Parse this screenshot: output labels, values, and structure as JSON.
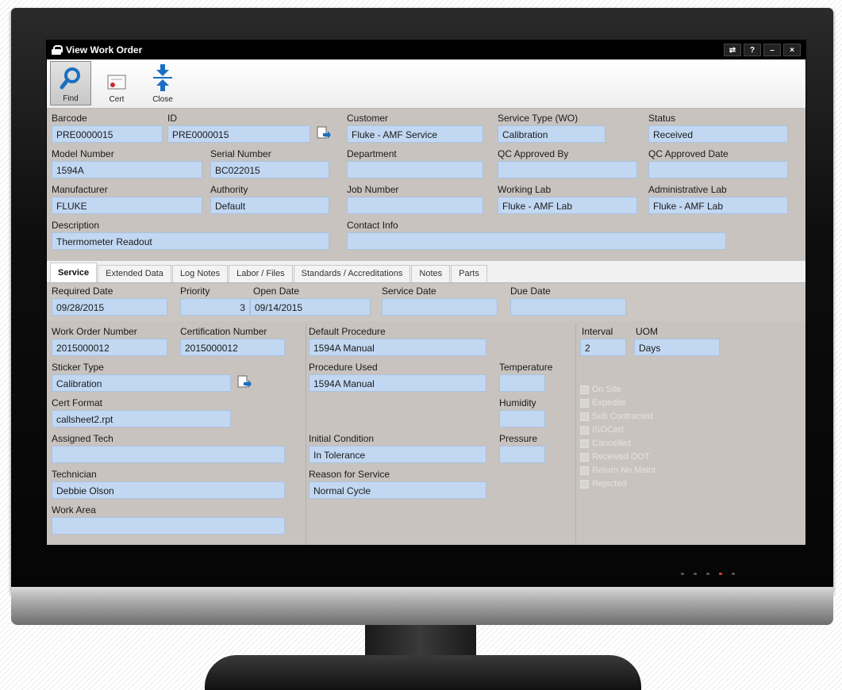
{
  "window": {
    "title": "View Work Order"
  },
  "toolbar": {
    "find": "Find",
    "cert": "Cert",
    "close": "Close"
  },
  "header": {
    "barcode_label": "Barcode",
    "barcode": "PRE0000015",
    "id_label": "ID",
    "id": "PRE0000015",
    "customer_label": "Customer",
    "customer": "Fluke - AMF Service",
    "service_type_label": "Service Type (WO)",
    "service_type": "Calibration",
    "status_label": "Status",
    "status": "Received",
    "model_label": "Model Number",
    "model": "1594A",
    "serial_label": "Serial Number",
    "serial": "BC022015",
    "department_label": "Department",
    "department": "",
    "qc_by_label": "QC Approved By",
    "qc_by": "",
    "qc_date_label": "QC Approved Date",
    "qc_date": "",
    "manufacturer_label": "Manufacturer",
    "manufacturer": "FLUKE",
    "authority_label": "Authority",
    "authority": "Default",
    "job_label": "Job Number",
    "job": "",
    "working_lab_label": "Working Lab",
    "working_lab": "Fluke - AMF Lab",
    "admin_lab_label": "Administrative Lab",
    "admin_lab": "Fluke - AMF Lab",
    "description_label": "Description",
    "description": "Thermometer Readout",
    "contact_label": "Contact Info",
    "contact": ""
  },
  "tabs": [
    "Service",
    "Extended Data",
    "Log Notes",
    "Labor / Files",
    "Standards / Accreditations",
    "Notes",
    "Parts"
  ],
  "service": {
    "required_date_label": "Required Date",
    "required_date": "09/28/2015",
    "priority_label": "Priority",
    "priority": "3",
    "open_date_label": "Open Date",
    "open_date": "09/14/2015",
    "service_date_label": "Service Date",
    "service_date": "",
    "due_date_label": "Due Date",
    "due_date": "",
    "wo_number_label": "Work Order Number",
    "wo_number": "2015000012",
    "cert_number_label": "Certification Number",
    "cert_number": "2015000012",
    "default_proc_label": "Default Procedure",
    "default_proc": "1594A Manual",
    "interval_label": "Interval",
    "interval": "2",
    "uom_label": "UOM",
    "uom": "Days",
    "sticker_label": "Sticker Type",
    "sticker": "Calibration",
    "proc_used_label": "Procedure Used",
    "proc_used": "1594A Manual",
    "temperature_label": "Temperature",
    "temperature": "",
    "cert_format_label": "Cert Format",
    "cert_format": "callsheet2.rpt",
    "humidity_label": "Humidity",
    "humidity": "",
    "assigned_tech_label": "Assigned Tech",
    "assigned_tech": "",
    "initial_cond_label": "Initial Condition",
    "initial_cond": "In Tolerance",
    "pressure_label": "Pressure",
    "pressure": "",
    "technician_label": "Technician",
    "technician": "Debbie Olson",
    "reason_label": "Reason for Service",
    "reason": "Normal Cycle",
    "work_area_label": "Work Area",
    "work_area": "",
    "checkboxes": [
      "On Site",
      "Expedite",
      "Sub Contracted",
      "ISOCert",
      "Cancelled",
      "Received OOT",
      "Return No Maint",
      "Rejected"
    ]
  },
  "colors": {
    "field_bg": "#c2d8f2",
    "panel_bg": "#c8c3bf",
    "titlebar": "#000000"
  }
}
